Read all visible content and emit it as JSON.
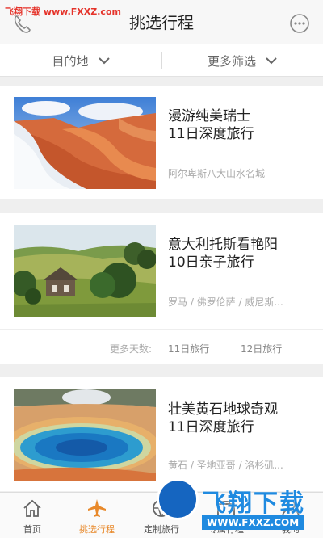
{
  "header": {
    "title": "挑选行程",
    "watermark_text": "飞翔下载 www.FXXZ.com"
  },
  "filters": {
    "destination_label": "目的地",
    "more_label": "更多筛选"
  },
  "trips": [
    {
      "name": "漫游纯美瑞士",
      "days": "11日深度旅行",
      "places": "阿尔卑斯八大山水名城"
    },
    {
      "name": "意大利托斯看艳阳",
      "days": "10日亲子旅行",
      "places": "罗马 / 佛罗伦萨 / 威尼斯..."
    },
    {
      "name": "壮美黄石地球奇观",
      "days": "11日深度旅行",
      "places": "黄石 / 圣地亚哥 / 洛杉矶..."
    }
  ],
  "more_days": {
    "label": "更多天数:",
    "options": [
      "11日旅行",
      "12日旅行"
    ]
  },
  "bottom_nav": {
    "active_color": "#e8892b",
    "items": [
      {
        "label": "首页",
        "icon": "home-icon"
      },
      {
        "label": "挑选行程",
        "icon": "airplane-icon"
      },
      {
        "label": "定制旅行",
        "icon": "globe-icon"
      },
      {
        "label": "专属行程",
        "icon": "briefcase-icon"
      },
      {
        "label": "我的",
        "icon": "person-icon"
      }
    ]
  },
  "watermark_logo": {
    "text": "飞翔下载",
    "url": "WWW.FXXZ.COM"
  }
}
